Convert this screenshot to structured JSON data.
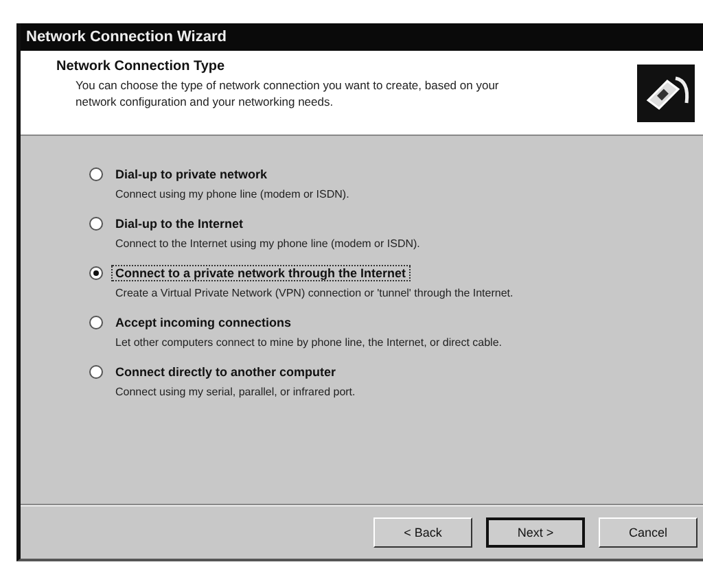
{
  "window": {
    "title": "Network Connection Wizard"
  },
  "header": {
    "title": "Network Connection Type",
    "description": "You can choose the type of network connection you want to create, based on your network configuration and your networking needs."
  },
  "options": [
    {
      "label": "Dial-up to private network",
      "description": "Connect using my phone line (modem or ISDN).",
      "selected": false
    },
    {
      "label": "Dial-up to the Internet",
      "description": "Connect to the Internet using my phone line (modem or ISDN).",
      "selected": false
    },
    {
      "label": "Connect to a private network through the Internet",
      "description": "Create a Virtual Private Network (VPN) connection or 'tunnel' through the Internet.",
      "selected": true
    },
    {
      "label": "Accept incoming connections",
      "description": "Let other computers connect to mine by phone line, the Internet, or direct cable.",
      "selected": false
    },
    {
      "label": "Connect directly to another computer",
      "description": "Connect using my serial, parallel, or infrared port.",
      "selected": false
    }
  ],
  "buttons": [
    {
      "label": "< Back",
      "default": false
    },
    {
      "label": "Next >",
      "default": true
    },
    {
      "label": "Cancel",
      "default": false
    }
  ]
}
